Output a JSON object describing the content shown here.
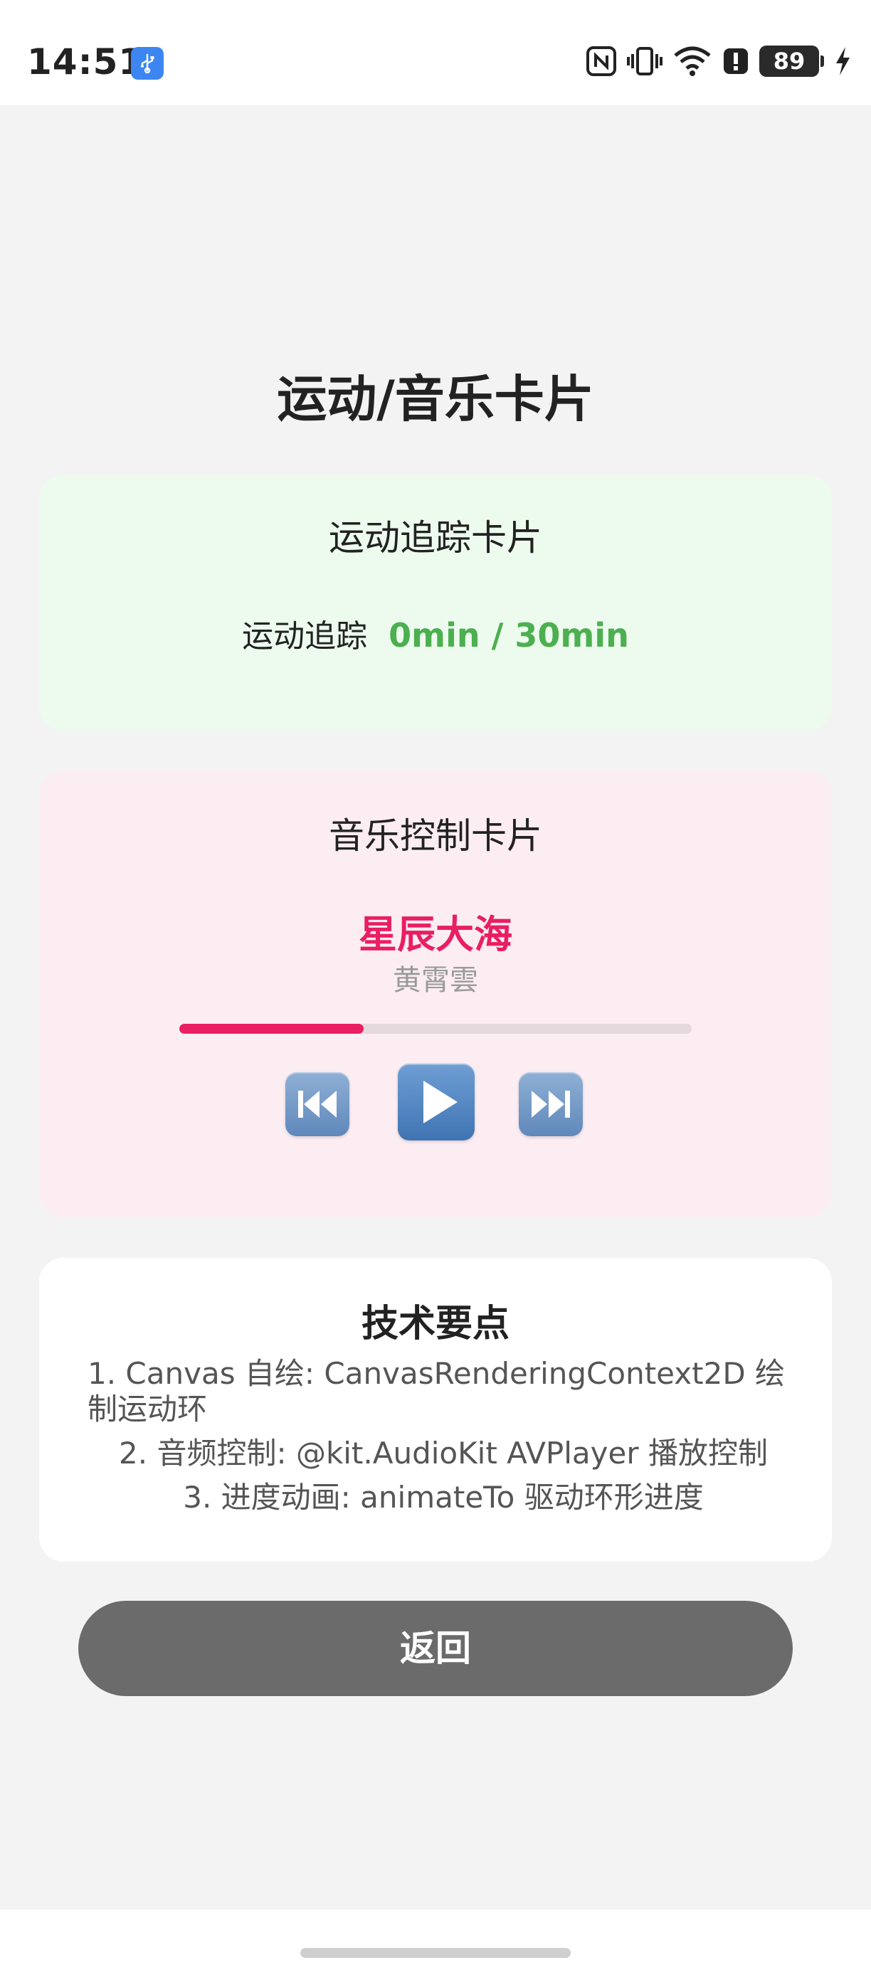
{
  "status_bar": {
    "time": "14:51",
    "battery": "89",
    "icons": [
      "usb-icon",
      "nfc-icon",
      "vibrate-icon",
      "wifi-icon",
      "alert-icon",
      "battery-icon",
      "charging-icon"
    ]
  },
  "page": {
    "title": "运动/音乐卡片"
  },
  "sport_card": {
    "title": "运动追踪卡片",
    "label": "运动追踪",
    "value": "0min / 30min",
    "accent": "#4caf50",
    "background": "#edfbee"
  },
  "music_card": {
    "title": "音乐控制卡片",
    "song": "星辰大海",
    "artist": "黄霄雲",
    "progress": 0.36,
    "accent": "#e91e63",
    "background": "#fcedf2",
    "controls": [
      "previous-track-icon",
      "play-icon",
      "next-track-icon"
    ]
  },
  "tech_card": {
    "title": "技术要点",
    "items": [
      "1. Canvas 自绘: CanvasRenderingContext2D 绘制运动环",
      "2. 音频控制: @kit.AudioKit AVPlayer 播放控制",
      "3. 进度动画: animateTo 驱动环形进度"
    ]
  },
  "back_button": {
    "label": "返回"
  }
}
